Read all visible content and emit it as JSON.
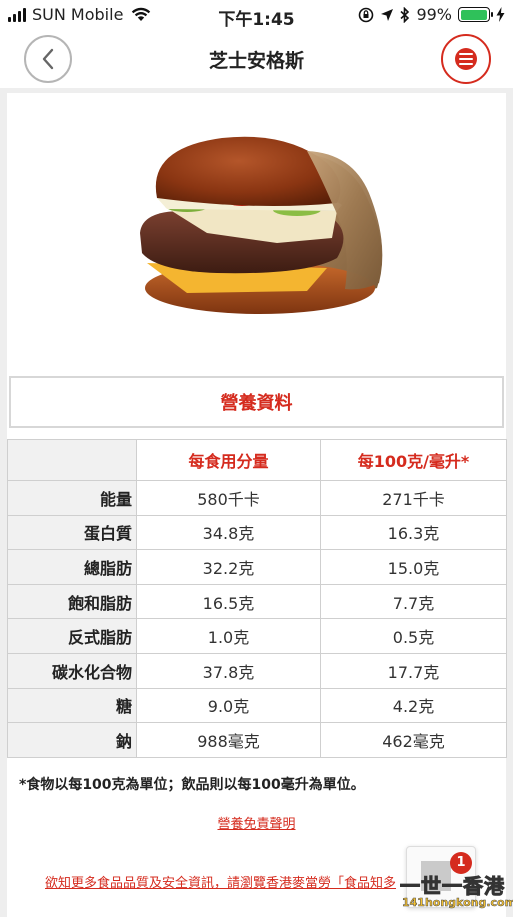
{
  "status_bar": {
    "carrier": "SUN Mobile",
    "time": "下午1:45",
    "battery": "99%",
    "battery_level": 0.99,
    "battery_color": "#2fc15a"
  },
  "header": {
    "title": "芝士安格斯",
    "back_icon": "chevron-left-icon",
    "menu_icon": "menu-icon",
    "accent_color": "#d52b1e"
  },
  "product": {
    "image_icon": "burger-image"
  },
  "nutrition": {
    "section_title": "營養資料",
    "columns": [
      "每食用分量",
      "每100克/毫升*"
    ],
    "rows": [
      {
        "label": "能量",
        "per_serving": "580千卡",
        "per_100": "271千卡"
      },
      {
        "label": "蛋白質",
        "per_serving": "34.8克",
        "per_100": "16.3克"
      },
      {
        "label": "總脂肪",
        "per_serving": "32.2克",
        "per_100": "15.0克"
      },
      {
        "label": "飽和脂肪",
        "per_serving": "16.5克",
        "per_100": "7.7克"
      },
      {
        "label": "反式脂肪",
        "per_serving": "1.0克",
        "per_100": "0.5克"
      },
      {
        "label": "碳水化合物",
        "per_serving": "37.8克",
        "per_100": "17.7克"
      },
      {
        "label": "糖",
        "per_serving": "9.0克",
        "per_100": "4.2克"
      },
      {
        "label": "鈉",
        "per_serving": "988毫克",
        "per_100": "462毫克"
      }
    ],
    "footnote": "*食物以每100克為單位；飲品則以每100毫升為單位。",
    "disclaimer_link": "營養免責聲明"
  },
  "more_info_link": "欲知更多食品品質及安全資訊，請瀏覽香港麥當勞「食品知多",
  "floating": {
    "badge_count": "1"
  },
  "watermark": {
    "top": "一世一香港",
    "bottom": "141hongkong.com"
  }
}
